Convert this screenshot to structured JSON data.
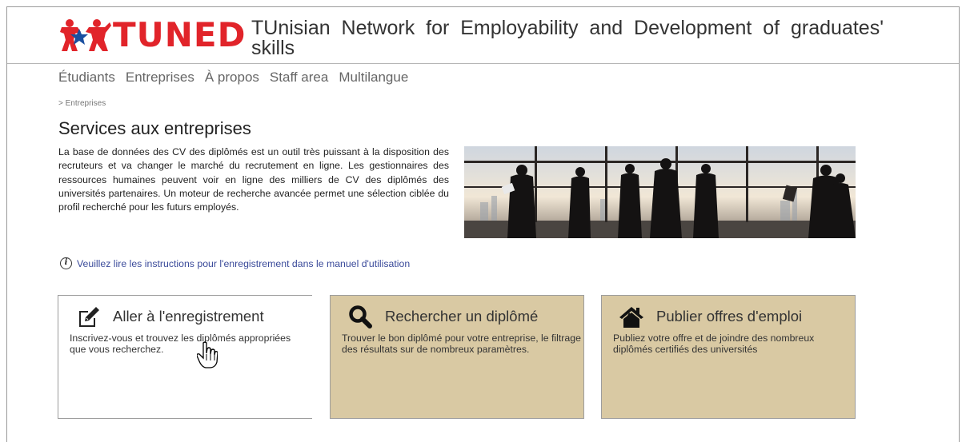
{
  "header": {
    "logo_text": "TUNED",
    "site_title": "TUnisian Network for Employability and Development of graduates' skills"
  },
  "nav": {
    "items": [
      {
        "label": "Étudiants"
      },
      {
        "label": "Entreprises"
      },
      {
        "label": "À propos"
      },
      {
        "label": "Staff area"
      },
      {
        "label": "Multilangue"
      }
    ]
  },
  "breadcrumb": "> Entreprises",
  "page_title": "Services aux entreprises",
  "intro": "La base de données des CV des diplômés est un outil très puissant à la disposition des recruteurs et va changer le marché du recrutement en ligne. Les gestionnaires des ressources humaines peuvent voir en ligne des milliers de CV des diplômés des universités partenaires. Un moteur de recherche avancée permet une sélection ciblée du profil recherché pour les futurs employés.",
  "info": {
    "icon": "info-circle-icon",
    "text": "Veuillez lire les instructions pour l'enregistrement dans le manuel d'utilisation"
  },
  "cards": [
    {
      "icon": "edit-icon",
      "title": "Aller à l'enregistrement",
      "desc": "Inscrivez-vous et trouvez les diplômés appropriées que vous recherchez."
    },
    {
      "icon": "search-icon",
      "title": "Rechercher un diplômé",
      "desc": "Trouver le bon diplômé pour votre entreprise, le filtrage des résultats sur de nombreux paramètres."
    },
    {
      "icon": "house-icon",
      "title": "Publier offres d'emploi",
      "desc": "Publiez votre offre et de joindre des nombreux diplômés certifiés des universités"
    }
  ],
  "colors": {
    "brand_red": "#e1242a",
    "card_tan": "#d9c9a3",
    "link_blue": "#3a4a9a"
  }
}
